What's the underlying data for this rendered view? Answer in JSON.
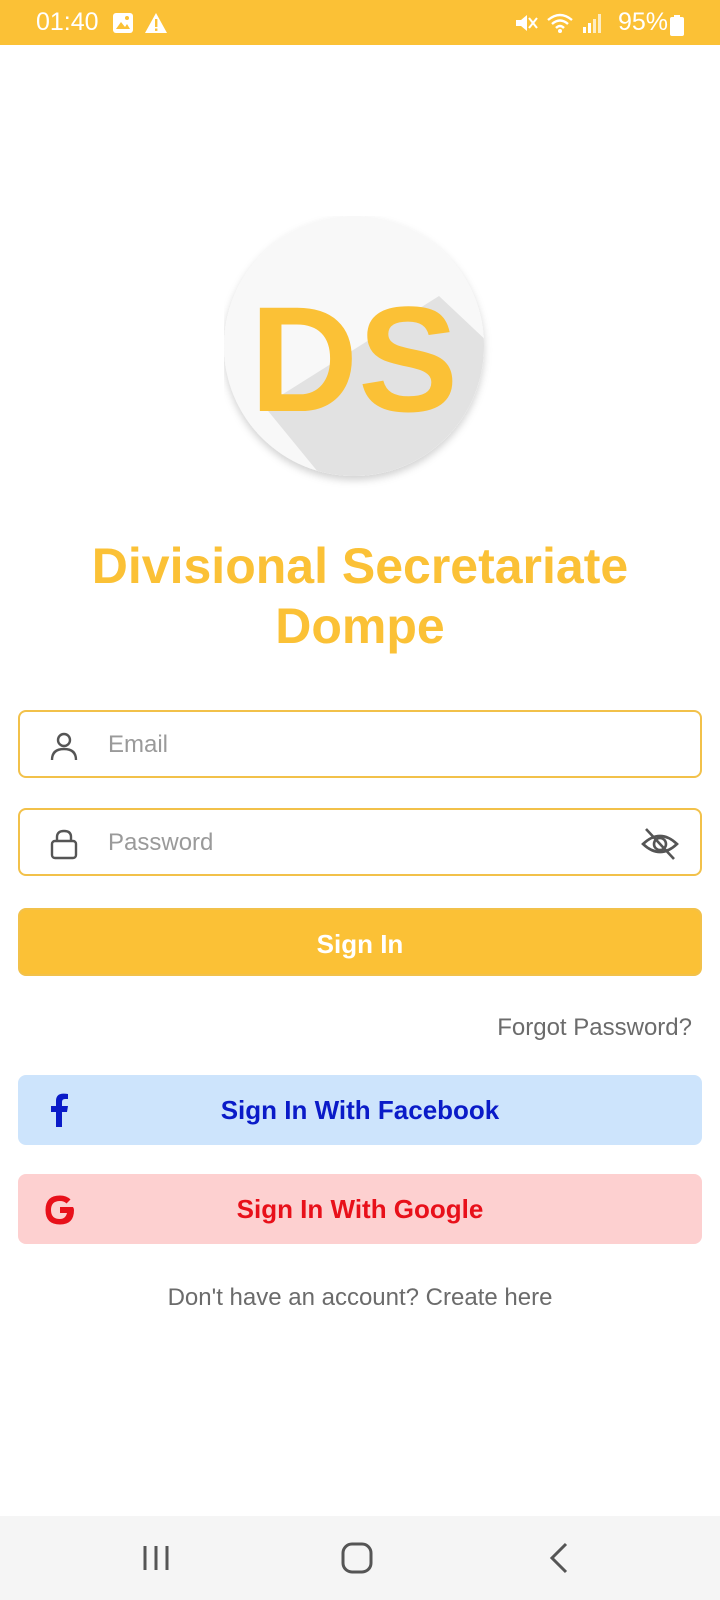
{
  "status_bar": {
    "time": "01:40",
    "battery": "95%",
    "icons_left": [
      "gallery-icon",
      "warning-icon"
    ],
    "icons_right": [
      "mute-icon",
      "wifi-icon",
      "signal-icon",
      "battery-icon"
    ]
  },
  "logo": {
    "text": "DS"
  },
  "app": {
    "title_line1": "Divisional Secretariate",
    "title_line2": "Dompe"
  },
  "form": {
    "email_placeholder": "Email",
    "password_placeholder": "Password"
  },
  "actions": {
    "sign_in": "Sign In",
    "forgot_password": "Forgot Password?",
    "facebook": "Sign In With Facebook",
    "google": "Sign In With Google",
    "create_account": "Don't have an account? Create here"
  },
  "colors": {
    "accent": "#FBC136",
    "facebook_bg": "#CDE4FC",
    "facebook_text": "#0A1BC8",
    "google_bg": "#FDD0D0",
    "google_text": "#E8101A"
  }
}
